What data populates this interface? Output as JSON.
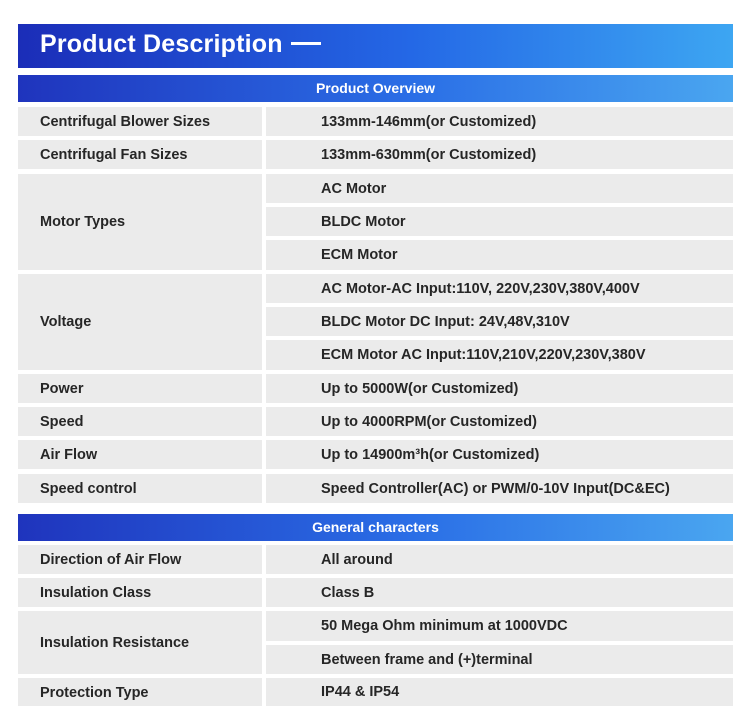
{
  "header": {
    "title": "Product Description"
  },
  "overview": {
    "title": "Product Overview",
    "rows": [
      {
        "label": "Centrifugal Blower Sizes",
        "values": [
          "133mm-146mm(or Customized)"
        ]
      },
      {
        "label": "Centrifugal Fan Sizes",
        "values": [
          "133mm-630mm(or Customized)"
        ]
      },
      {
        "label": "Motor Types",
        "values": [
          "AC Motor",
          "BLDC Motor",
          "ECM Motor"
        ]
      },
      {
        "label": "Voltage",
        "values": [
          "AC Motor-AC Input:110V, 220V,230V,380V,400V",
          "BLDC Motor DC Input: 24V,48V,310V",
          "ECM Motor AC Input:110V,210V,220V,230V,380V"
        ]
      },
      {
        "label": "Power",
        "values": [
          "Up to 5000W(or Customized)"
        ]
      },
      {
        "label": "Speed",
        "values": [
          "Up to 4000RPM(or Customized)"
        ]
      },
      {
        "label": "Air Flow",
        "values": [
          "Up to 14900m³h(or Customized)"
        ]
      },
      {
        "label": "Speed control",
        "values": [
          "Speed Controller(AC) or PWM/0-10V Input(DC&EC)"
        ]
      }
    ]
  },
  "general": {
    "title": "General characters",
    "rows": [
      {
        "label": "Direction of Air Flow",
        "values": [
          "All around"
        ]
      },
      {
        "label": "Insulation Class",
        "values": [
          "Class B"
        ]
      },
      {
        "label": "Insulation Resistance",
        "values": [
          "50 Mega Ohm minimum at 1000VDC",
          "Between frame and (+)terminal"
        ]
      },
      {
        "label": "Protection Type",
        "values": [
          "IP44 & IP54"
        ]
      }
    ]
  }
}
